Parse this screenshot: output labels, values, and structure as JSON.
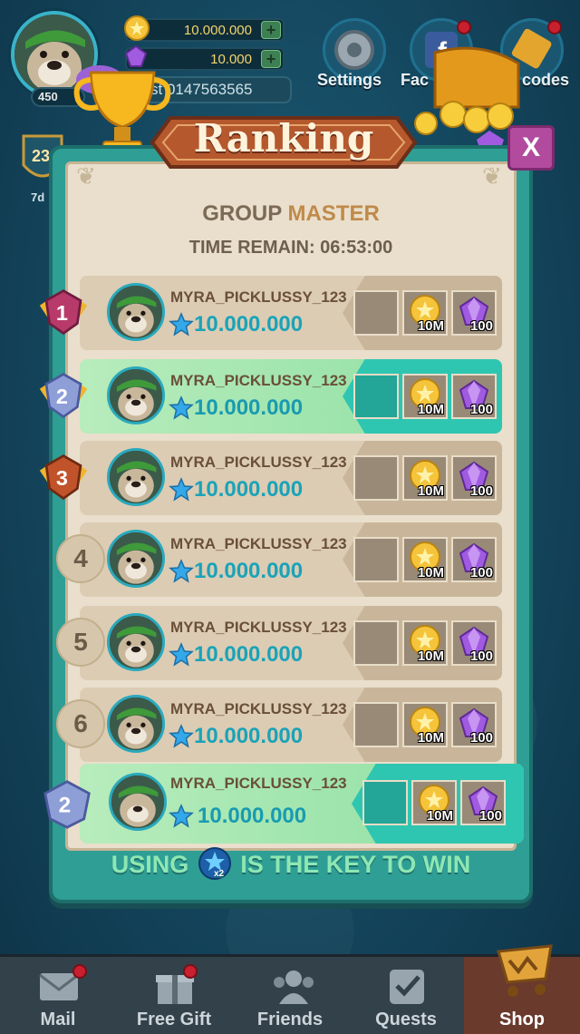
{
  "hud": {
    "level": "450",
    "coins": "10.000.000",
    "gems": "10.000",
    "player_id": "st 0147563565",
    "settings_label": "Settings",
    "facebook_label": "Fac",
    "giftcodes_label": "codes",
    "side_badge_number": "23",
    "side_badge_time": "7d"
  },
  "panel": {
    "title": "Ranking",
    "close_label": "X",
    "group_prefix": "GROUP ",
    "group_value": "MASTER",
    "time_label": "TIME REMAIN: 06:53:00",
    "hint_before": "USING",
    "hint_after": "IS THE KEY TO WIN",
    "hint_badge": "x2"
  },
  "rows": [
    {
      "rank": "1",
      "name": "MYRA_PICKLUSSY_123",
      "score": "10.000.000",
      "coin_reward": "10M",
      "gem_reward": "100"
    },
    {
      "rank": "2",
      "name": "MYRA_PICKLUSSY_123",
      "score": "10.000.000",
      "coin_reward": "10M",
      "gem_reward": "100"
    },
    {
      "rank": "3",
      "name": "MYRA_PICKLUSSY_123",
      "score": "10.000.000",
      "coin_reward": "10M",
      "gem_reward": "100"
    },
    {
      "rank": "4",
      "name": "MYRA_PICKLUSSY_123",
      "score": "10.000.000",
      "coin_reward": "10M",
      "gem_reward": "100"
    },
    {
      "rank": "5",
      "name": "MYRA_PICKLUSSY_123",
      "score": "10.000.000",
      "coin_reward": "10M",
      "gem_reward": "100"
    },
    {
      "rank": "6",
      "name": "MYRA_PICKLUSSY_123",
      "score": "10.000.000",
      "coin_reward": "10M",
      "gem_reward": "100"
    }
  ],
  "my_row": {
    "rank": "2",
    "name": "MYRA_PICKLUSSY_123",
    "score": "10.000.000",
    "coin_reward": "10M",
    "gem_reward": "100"
  },
  "nav": {
    "mail": "Mail",
    "free_gift": "Free Gift",
    "friends": "Friends",
    "quests": "Quests",
    "shop": "Shop"
  },
  "colors": {
    "highlight_row": "#8ddfa2",
    "reward_teal": "#2fc6b1",
    "score_blue": "#1aa3b9"
  }
}
